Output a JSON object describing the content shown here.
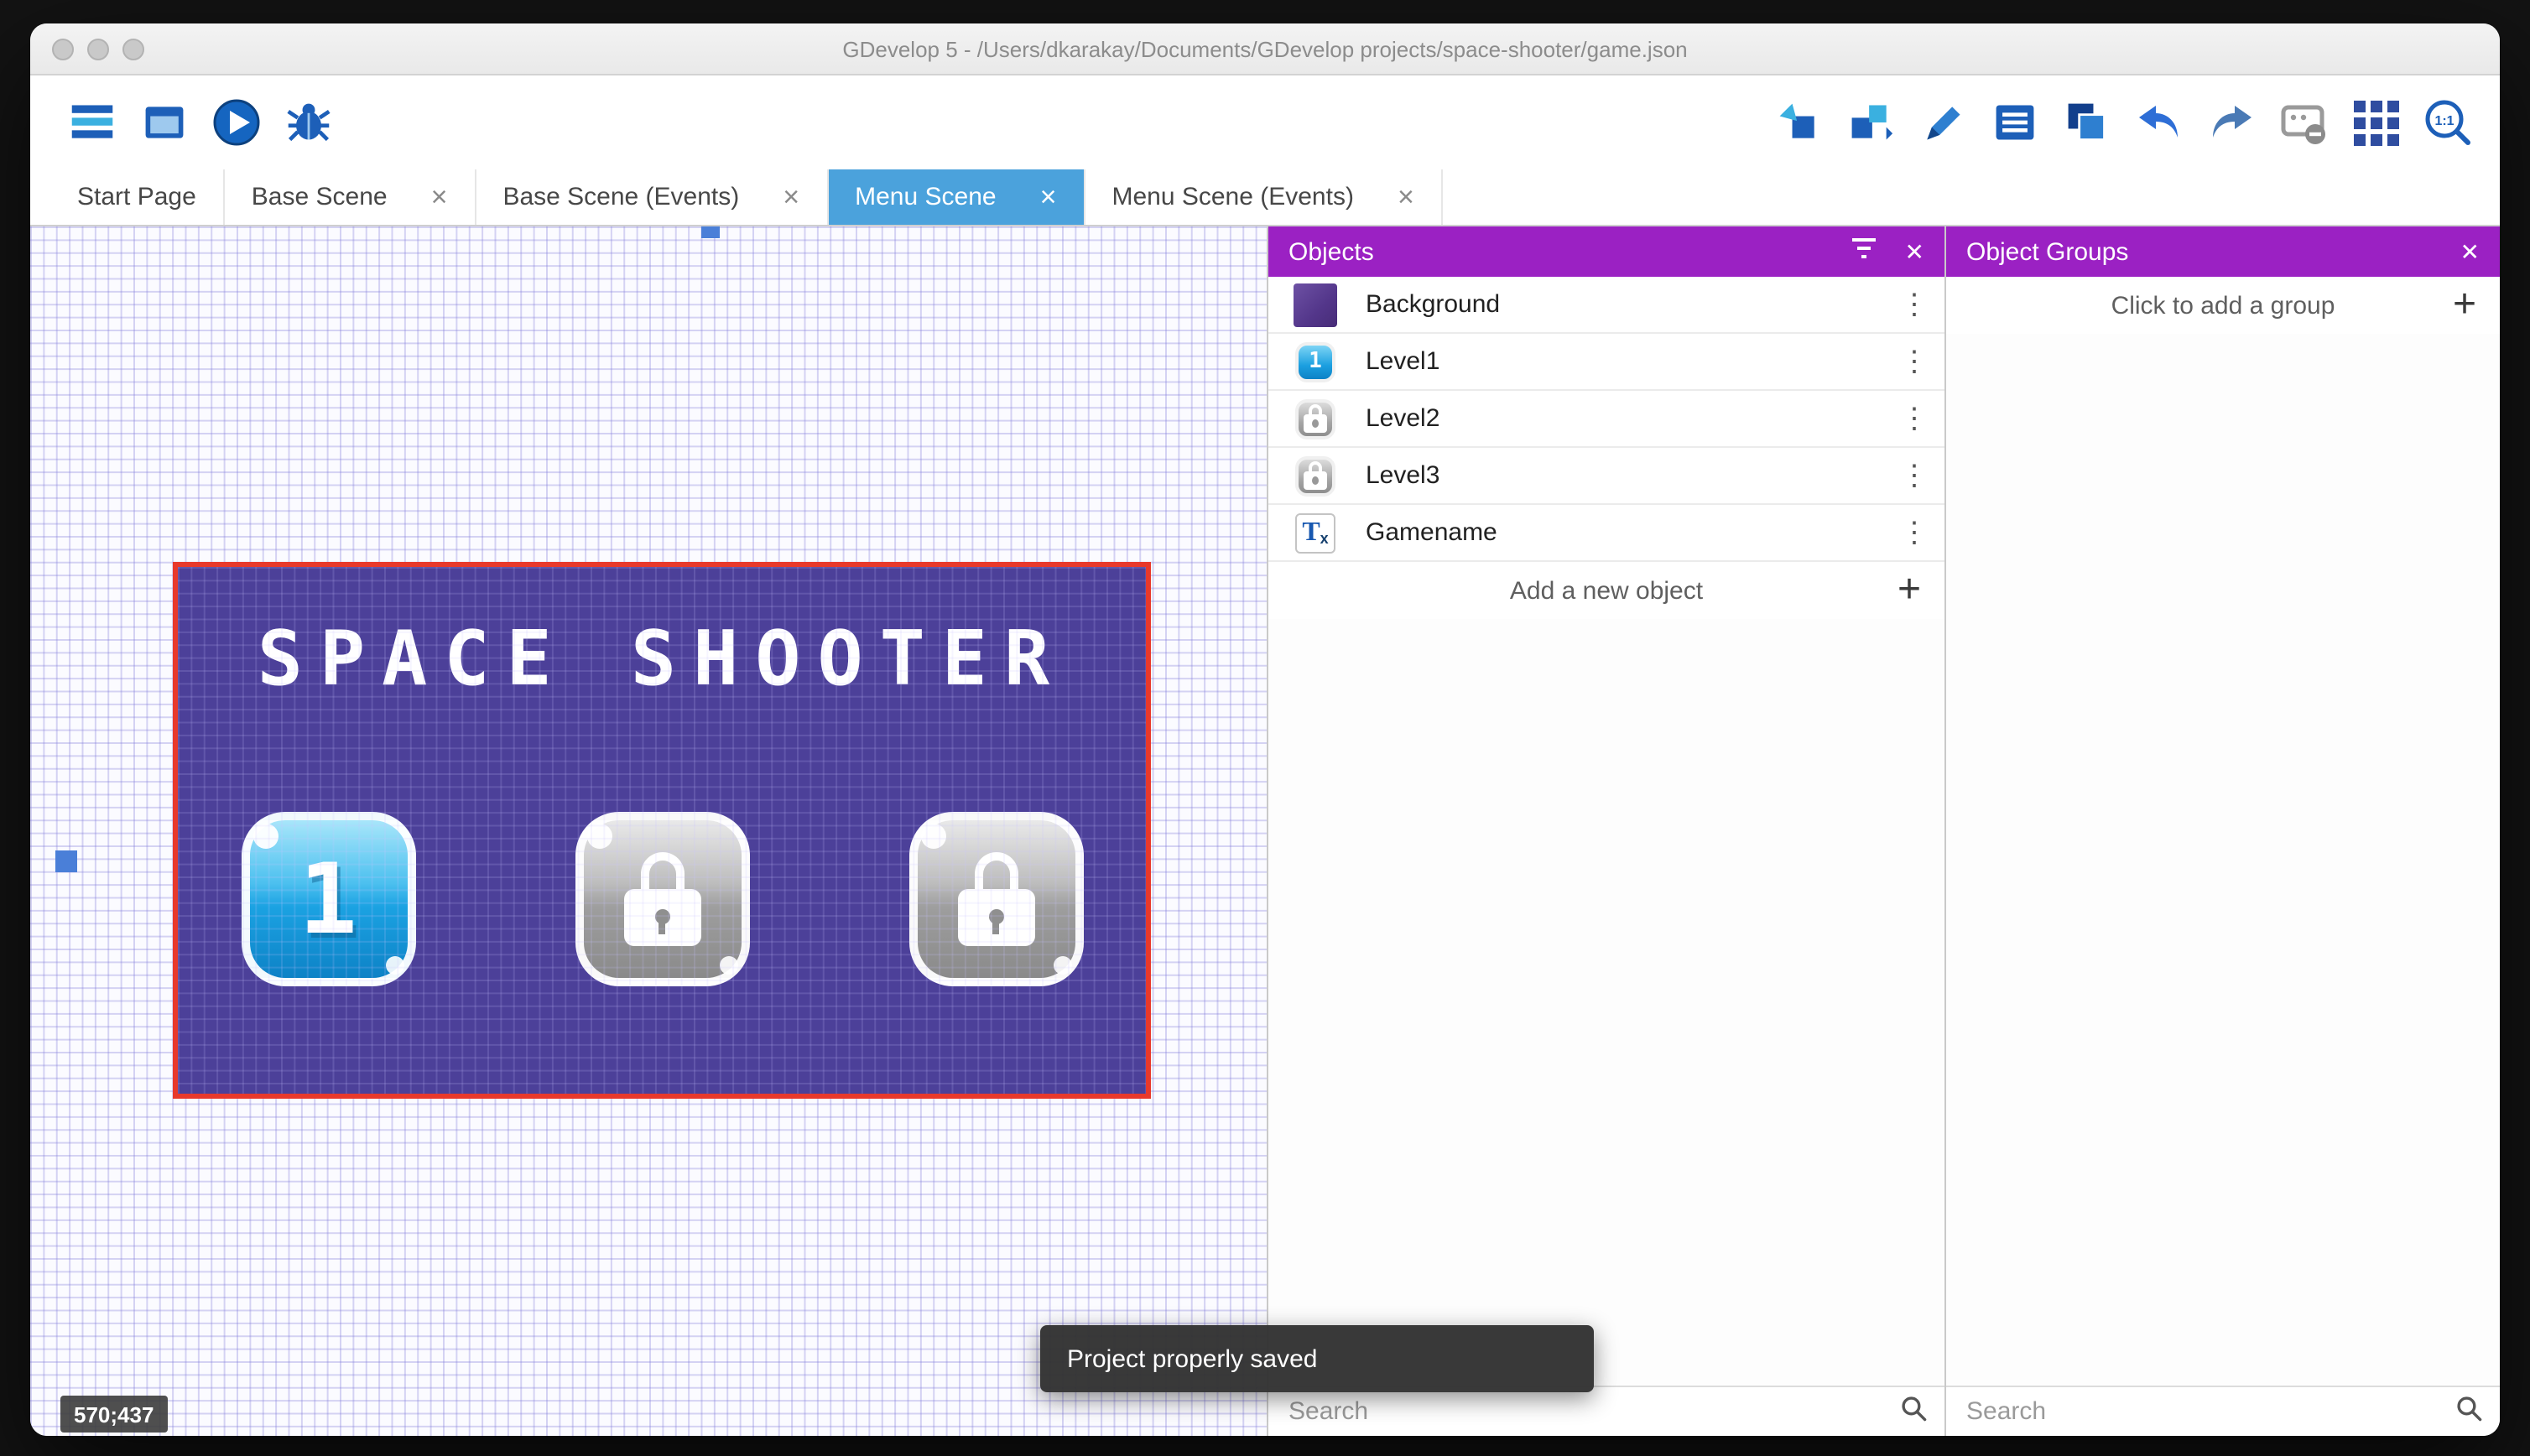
{
  "titlebar": {
    "title": "GDevelop 5 - /Users/dkarakay/Documents/GDevelop projects/space-shooter/game.json"
  },
  "toolbar": {
    "left_icons": [
      "project-manager-icon",
      "window-icon",
      "preview-play-icon",
      "debug-bug-icon"
    ],
    "right_icons": [
      "insert-object-icon",
      "object-groups-icon",
      "edit-pencil-icon",
      "instances-list-icon",
      "layers-icon",
      "undo-icon",
      "redo-icon",
      "window-mask-icon",
      "grid-icon",
      "zoom-1-1-icon"
    ],
    "zoom_icon_label": "1:1"
  },
  "tabs": {
    "close_glyph": "×",
    "items": [
      {
        "label": "Start Page",
        "active": false,
        "closable": false
      },
      {
        "label": "Base Scene",
        "active": false,
        "closable": true
      },
      {
        "label": "Base Scene (Events)",
        "active": false,
        "closable": true
      },
      {
        "label": "Menu Scene",
        "active": true,
        "closable": true
      },
      {
        "label": "Menu Scene (Events)",
        "active": false,
        "closable": true
      }
    ]
  },
  "canvas": {
    "coordinate_readout": "570;437",
    "scene_title": "SPACE SHOOTER",
    "level_button_label": "1"
  },
  "objects_panel": {
    "title": "Objects",
    "close_glyph": "✕",
    "menu_glyph": "⋮",
    "plus_glyph": "+",
    "level1_icon_glyph": "1",
    "text_icon_glyph": "T",
    "text_icon_sub": "x",
    "items": [
      {
        "name": "Background",
        "icon": "background-swatch-icon"
      },
      {
        "name": "Level1",
        "icon": "level1-button-icon"
      },
      {
        "name": "Level2",
        "icon": "locked-button-icon"
      },
      {
        "name": "Level3",
        "icon": "locked-button-icon"
      },
      {
        "name": "Gamename",
        "icon": "text-object-icon"
      }
    ],
    "add_new_label": "Add a new object",
    "search_placeholder": "Search"
  },
  "object_groups_panel": {
    "title": "Object Groups",
    "close_glyph": "✕",
    "plus_glyph": "+",
    "add_group_label": "Click to add a group",
    "search_placeholder": "Search"
  },
  "snackbar": {
    "message": "Project properly saved"
  },
  "colors": {
    "panel_header_purple": "#9b21c3",
    "active_tab_blue": "#4ba2dc",
    "selection_red": "#e8392b",
    "scene_background_purple": "#4c4099",
    "toolbar_icon_blue": "#1d5fb8"
  }
}
